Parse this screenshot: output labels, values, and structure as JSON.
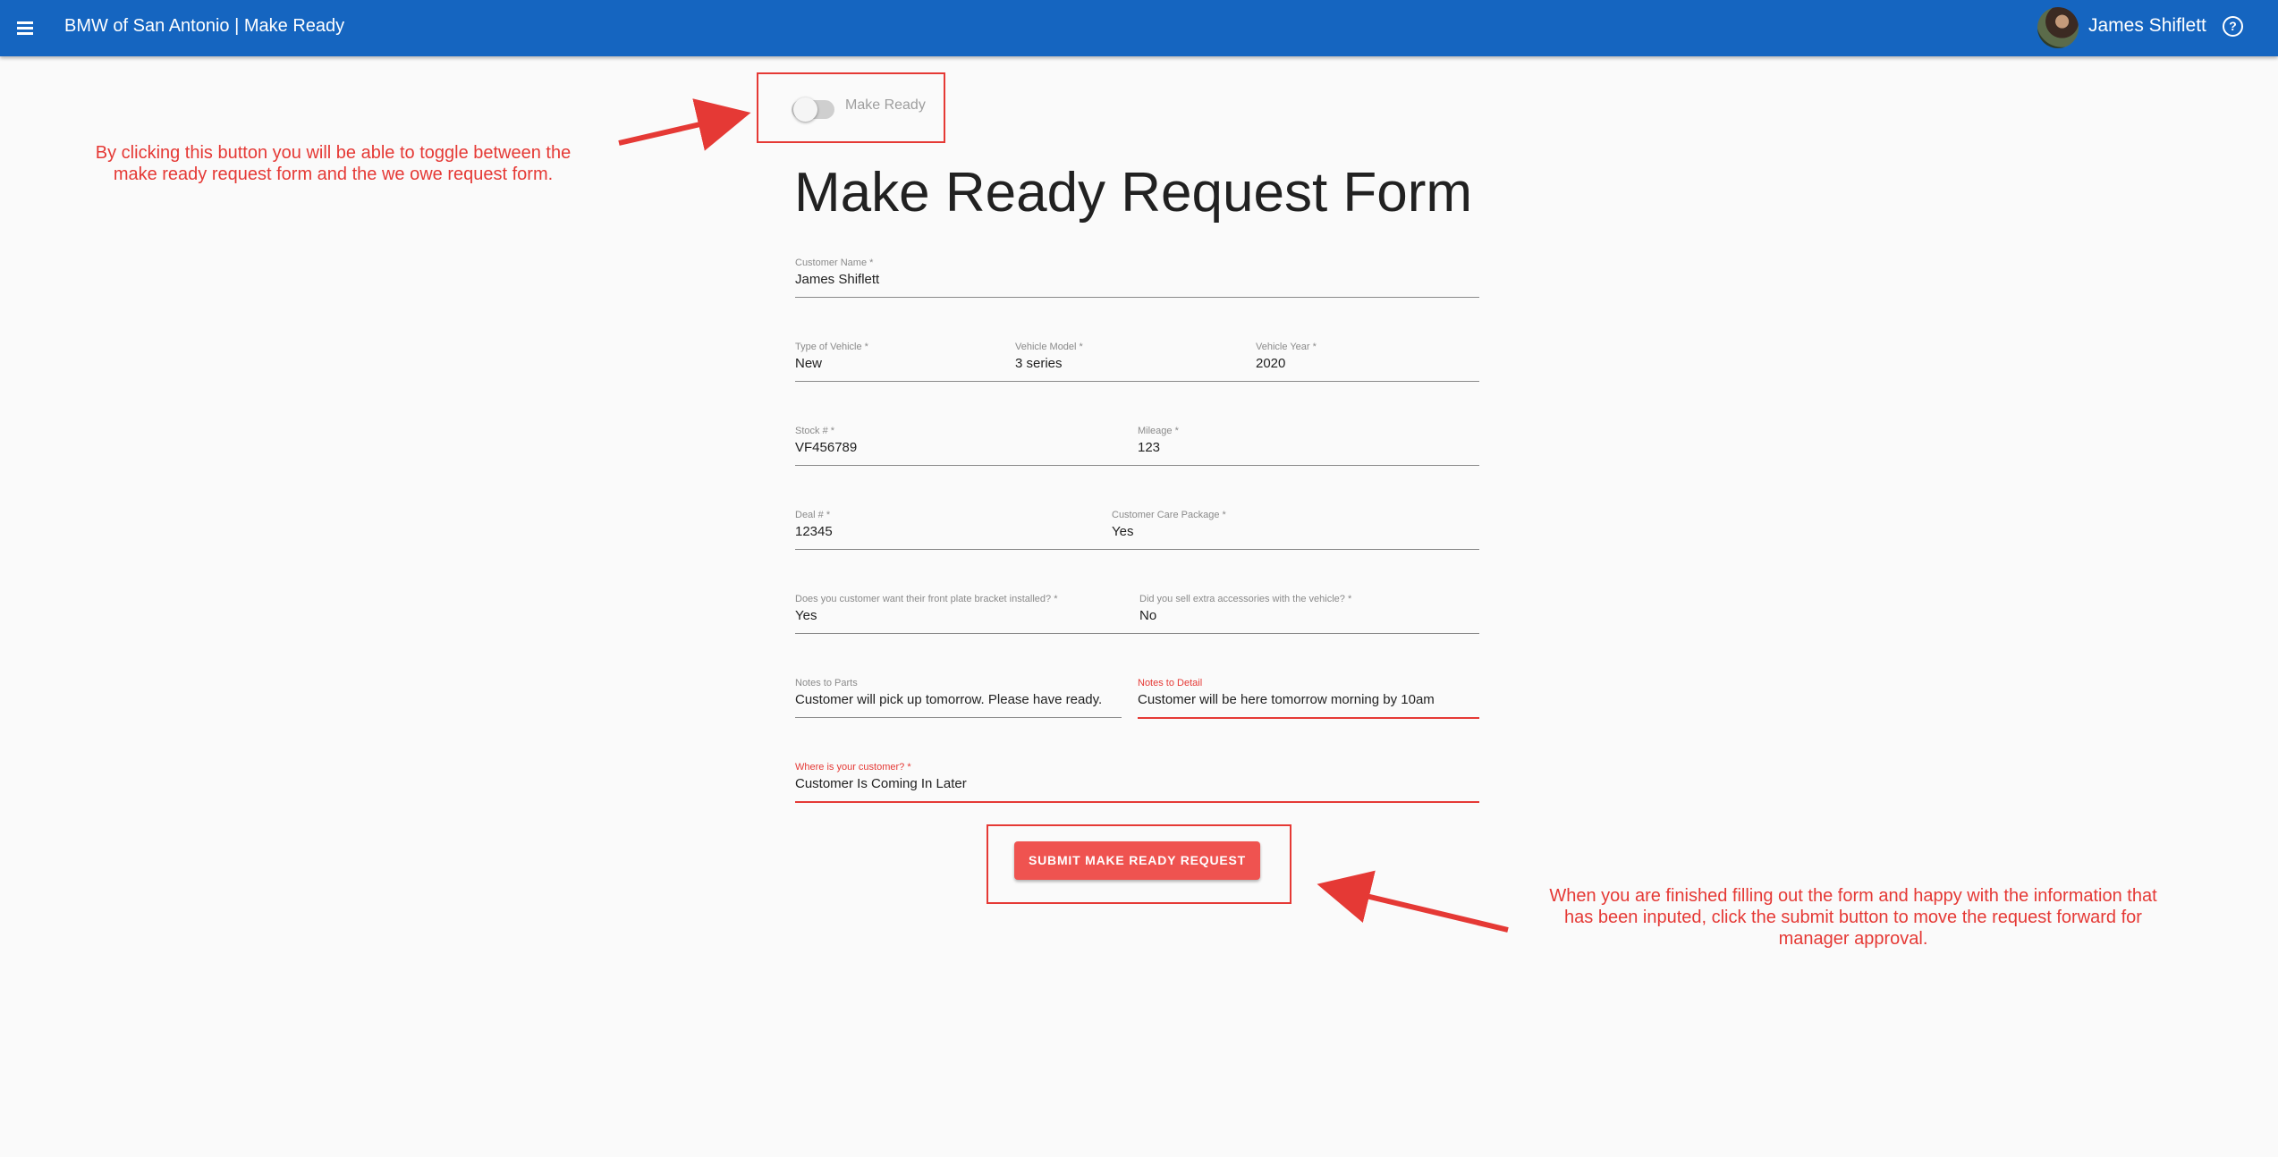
{
  "header": {
    "title": "BMW of San Antonio | Make Ready",
    "user_name": "James Shiflett",
    "menu_icon": "menu-icon",
    "help_icon": "help-circle-icon",
    "help_glyph": "?",
    "color": "#1565c0"
  },
  "toggle": {
    "label": "Make Ready",
    "checked": false
  },
  "form": {
    "title": "Make Ready Request Form",
    "fields": {
      "customer_name": {
        "label": "Customer Name *",
        "value": "James Shiflett"
      },
      "type_of_vehicle": {
        "label": "Type of Vehicle *",
        "value": "New"
      },
      "vehicle_model": {
        "label": "Vehicle Model *",
        "value": "3 series"
      },
      "vehicle_year": {
        "label": "Vehicle Year *",
        "value": "2020"
      },
      "stock_number": {
        "label": "Stock # *",
        "value": "VF456789"
      },
      "mileage": {
        "label": "Mileage *",
        "value": "123"
      },
      "deal_number": {
        "label": "Deal # *",
        "value": "12345"
      },
      "customer_care_package": {
        "label": "Customer Care Package *",
        "value": "Yes"
      },
      "front_plate_bracket": {
        "label": "Does you customer want their front plate bracket installed? *",
        "value": "Yes"
      },
      "extra_accessories": {
        "label": "Did you sell extra accessories with the vehicle? *",
        "value": "No"
      },
      "notes_to_parts": {
        "label": "Notes to Parts",
        "value": "Customer will pick up tomorrow. Please have ready."
      },
      "notes_to_detail": {
        "label": "Notes to Detail",
        "value": "Customer will be here tomorrow morning by 10am"
      },
      "customer_location": {
        "label": "Where is your customer? *",
        "value": "Customer Is Coming In Later"
      }
    },
    "submit_label": "SUBMIT MAKE READY REQUEST",
    "submit_color": "#ef5350",
    "error_color": "#e53935"
  },
  "annotations": {
    "toggle_note": "By clicking this button you will be able to toggle between the make ready request form and the we owe request form.",
    "submit_note": "When you are finished filling out the form and happy with the information that has been inputed, click the submit button to move the request forward for manager approval.",
    "color": "#e53935"
  }
}
